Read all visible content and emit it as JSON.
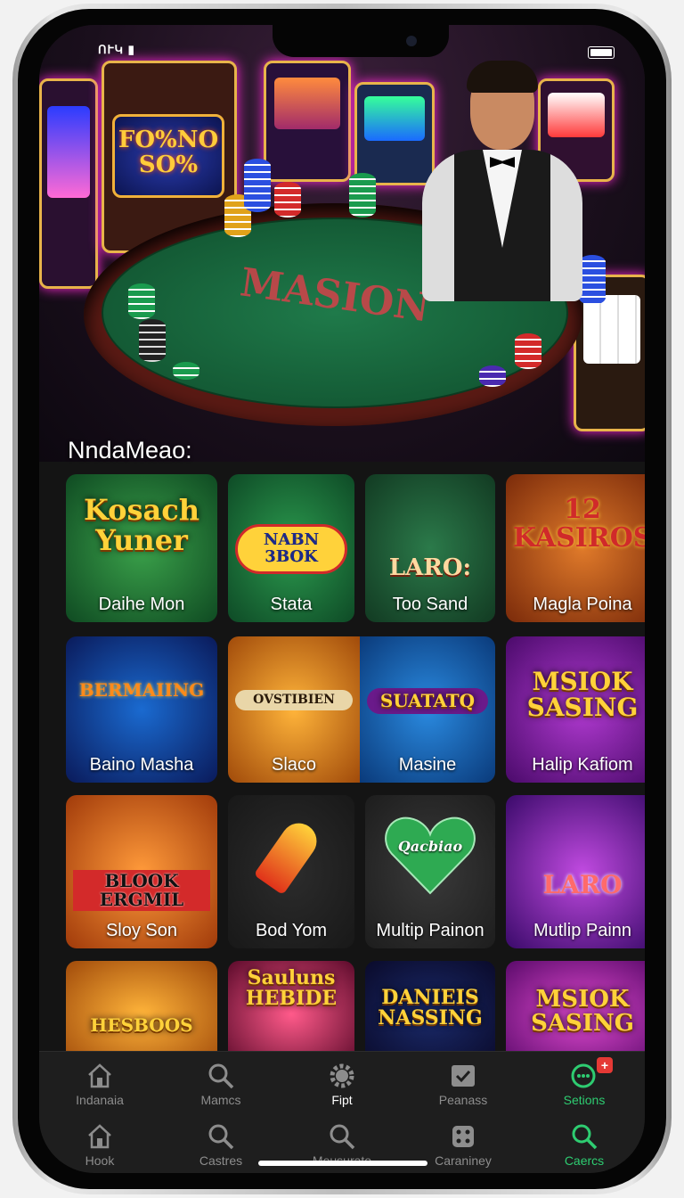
{
  "status_bar": {
    "signal_text": "ՈՒԿ ▮"
  },
  "hero": {
    "sign_text": "FO%NO\nSO%",
    "table_text": "MASION"
  },
  "section_title": "NndaMeao:",
  "tiles": [
    {
      "logo": "Kosach\nYuner",
      "label": "Daihe Mon"
    },
    {
      "logo": "NABN 3BOK",
      "label": "Stata"
    },
    {
      "logo": "LARO:",
      "label": "Too Sand"
    },
    {
      "logo": "12\nKASIROS",
      "label": "Magla Poina"
    },
    {
      "logo": "BERMAIING",
      "label": "Baino Masha"
    },
    {
      "logo": "OVSTIBIEN",
      "label": "Slaco"
    },
    {
      "logo": "SUATATQ",
      "label": "Masine"
    },
    {
      "logo": "MSIOK\nSASING",
      "label": "Halip Kafiom"
    },
    {
      "logo": "BLOOK\nERGMIL",
      "label": "Sloy Son"
    },
    {
      "logo": "",
      "label": "Bod Yom"
    },
    {
      "logo": "Qacbiao",
      "label": "Multip Painon"
    },
    {
      "logo": "LARO",
      "label": "Mutlip Painn"
    },
    {
      "logo": "HESBOOS",
      "label": ""
    },
    {
      "logo": "Sauluns\nHEBIDE",
      "label": ""
    },
    {
      "logo": "DANIEIS\nNASSING",
      "label": ""
    },
    {
      "logo": "MSIOK\nSASING",
      "label": ""
    }
  ],
  "nav_row1": [
    {
      "label": "Indanaia",
      "icon": "home-icon"
    },
    {
      "label": "Mamcs",
      "icon": "search-icon"
    },
    {
      "label": "Fipt",
      "icon": "gear-icon"
    },
    {
      "label": "Peanass",
      "icon": "checkbox-icon"
    },
    {
      "label": "Setions",
      "icon": "chat-icon",
      "badge": "+"
    }
  ],
  "nav_row2": [
    {
      "label": "Hook",
      "icon": "home-icon"
    },
    {
      "label": "Castres",
      "icon": "search-icon"
    },
    {
      "label": "Meusurato",
      "icon": "search-icon"
    },
    {
      "label": "Caraniney",
      "icon": "dice-icon"
    },
    {
      "label": "Caercs",
      "icon": "search-icon"
    }
  ],
  "colors": {
    "accent": "#2ecc71",
    "background": "#141414",
    "nav_bg": "#1e1e1e"
  }
}
